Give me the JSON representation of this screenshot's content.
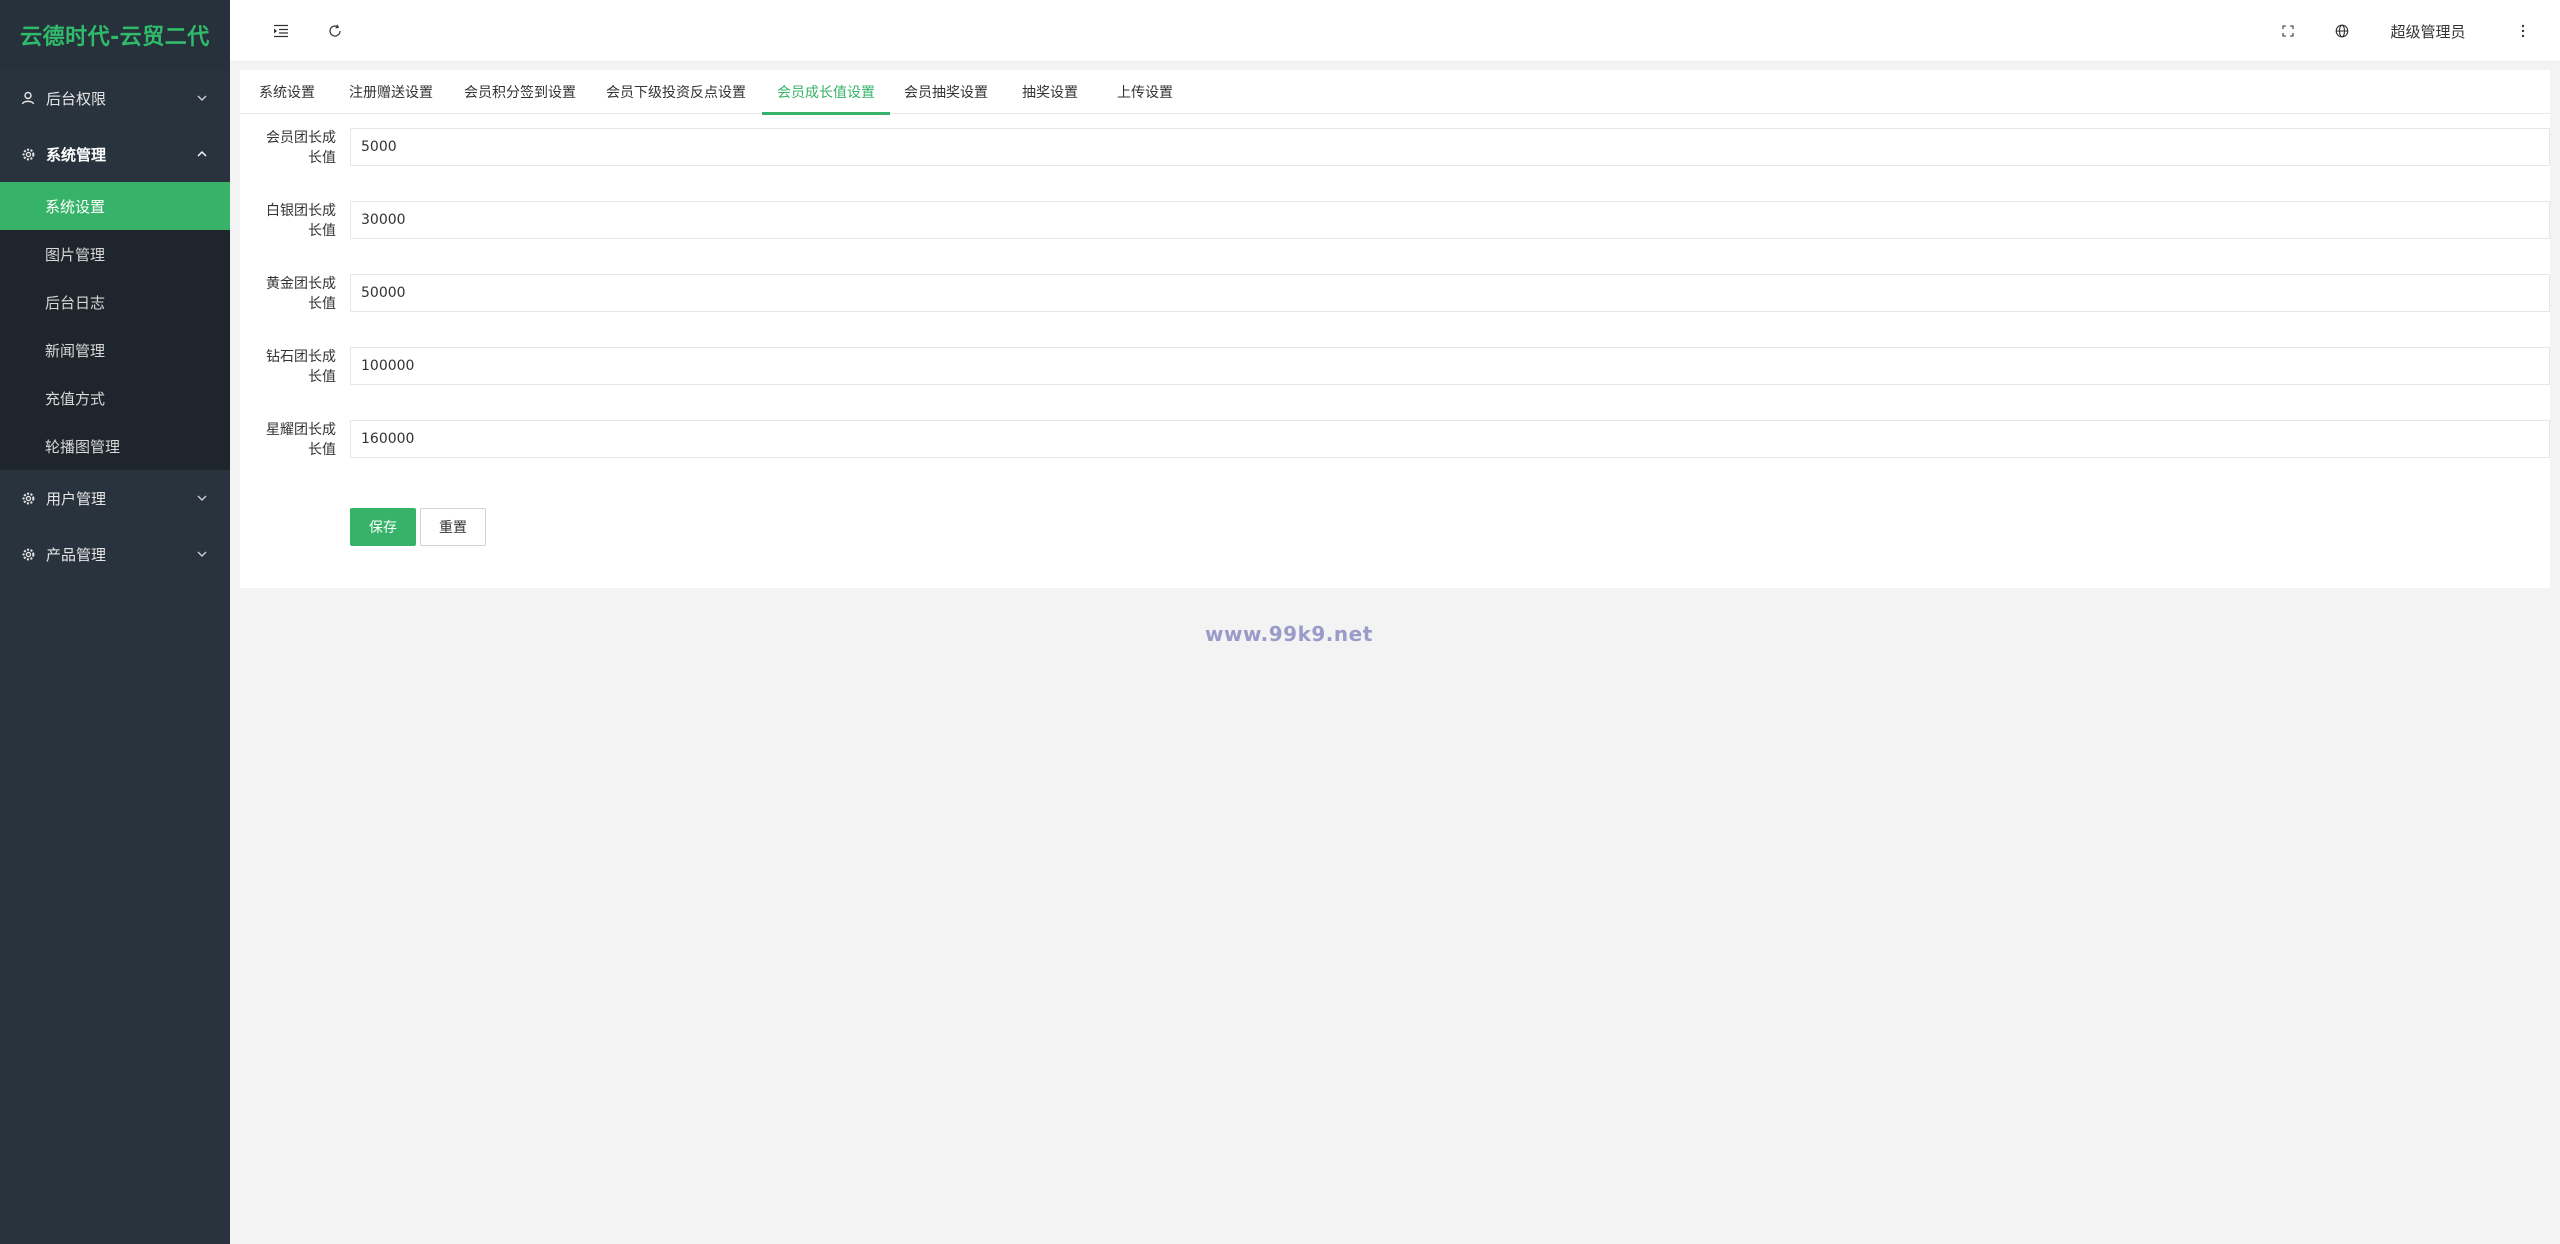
{
  "app": {
    "title": "云德时代-云贸二代"
  },
  "sidebar": {
    "groups": [
      {
        "label": "后台权限",
        "icon": "user-icon",
        "expanded": false
      },
      {
        "label": "系统管理",
        "icon": "gear-icon",
        "expanded": true,
        "items": [
          {
            "label": "系统设置",
            "active": true
          },
          {
            "label": "图片管理"
          },
          {
            "label": "后台日志"
          },
          {
            "label": "新闻管理"
          },
          {
            "label": "充值方式"
          },
          {
            "label": "轮播图管理"
          }
        ]
      },
      {
        "label": "用户管理",
        "icon": "gear-icon",
        "expanded": false
      },
      {
        "label": "产品管理",
        "icon": "gear-icon",
        "expanded": false
      }
    ]
  },
  "header": {
    "admin_name": "超级管理员",
    "icons": [
      "menu-toggle-icon",
      "refresh-icon",
      "fullscreen-icon",
      "language-icon",
      "more-icon"
    ]
  },
  "tabs": [
    {
      "label": "系统设置"
    },
    {
      "label": "注册赠送设置"
    },
    {
      "label": "会员积分签到设置"
    },
    {
      "label": "会员下级投资反点设置"
    },
    {
      "label": "会员成长值设置",
      "active": true
    },
    {
      "label": "会员抽奖设置"
    },
    {
      "label": "抽奖设置"
    },
    {
      "label": "上传设置"
    }
  ],
  "form": {
    "fields": [
      {
        "label": "会员团长成长值",
        "value": "5000"
      },
      {
        "label": "白银团长成长值",
        "value": "30000"
      },
      {
        "label": "黄金团长成长值",
        "value": "50000"
      },
      {
        "label": "钻石团长成长值",
        "value": "100000"
      },
      {
        "label": "星耀团长成长值",
        "value": "160000"
      }
    ],
    "save_label": "保存",
    "reset_label": "重置"
  },
  "watermark": "www.99k9.net",
  "colors": {
    "accent": "#36b368",
    "sidebar_bg": "#28333e",
    "submenu_bg": "#1e252c",
    "logo": "#2fbb6a"
  }
}
